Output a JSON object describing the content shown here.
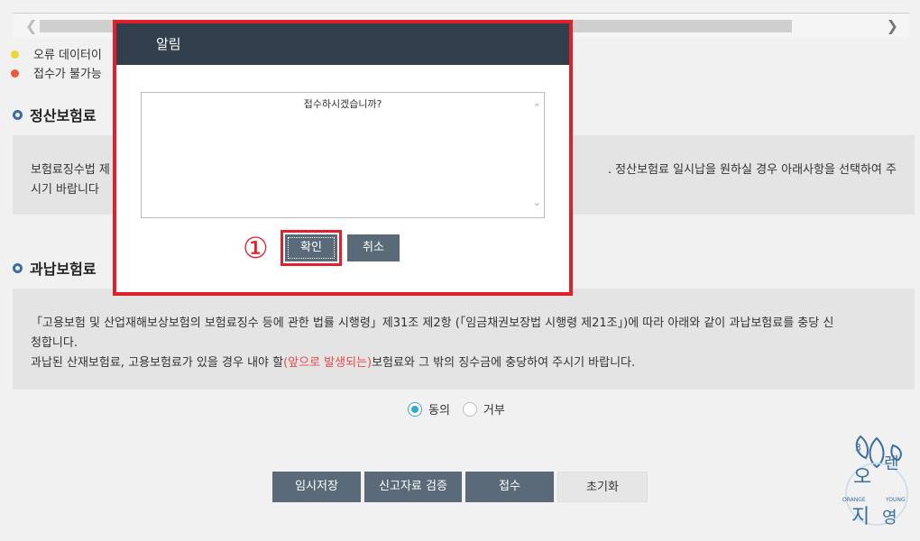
{
  "legend": {
    "item1": "오류 데이터이",
    "item2": "접수가 불가능",
    "colors": {
      "yellow": "#e8d838",
      "red": "#e85c3c"
    }
  },
  "section1": {
    "title": "정산보험료",
    "text_left": "보험료징수법 제",
    "text_right": ". 정산보험료 일시납을 원하실 경우 아래사항을 선택하여 주",
    "text_line2": "시기 바랍니다"
  },
  "section2": {
    "title": "과납보험료",
    "line1": "「고용보험 및 산업재해보상보험의 보험료징수 등에 관한 법률 시행령」제31조 제2항 (「임금채권보장법 시행령 제21조」)에 따라 아래와 같이 과납보험료를 충당 신",
    "line2": "청합니다.",
    "line3_a": "과납된 산재보험료, 고용보험료가 있을 경우 내야 할",
    "line3_red": "(앞으로 발생되는)",
    "line3_b": "보험료와 그 밖의 징수금에 충당하여 주시기 바랍니다."
  },
  "consent": {
    "agree": "동의",
    "refuse": "거부",
    "selected": "agree"
  },
  "buttons": {
    "temp_save": "임시저장",
    "verify": "신고자료 검증",
    "submit": "접수",
    "reset": "초기화"
  },
  "modal": {
    "title": "알림",
    "message": "접수하시겠습니까?",
    "ok": "확인",
    "cancel": "취소",
    "annotation": "①"
  },
  "logo": {
    "top": "오",
    "right": "렌",
    "bottom_left": "지",
    "bottom_right": "영",
    "left_text": "ORANGE",
    "right_text": "YOUNG",
    "num": "3"
  },
  "colors": {
    "header_dark": "#313f4d",
    "button": "#5a6a78",
    "highlight": "#e0202a",
    "radio": "#3aa6c6"
  }
}
